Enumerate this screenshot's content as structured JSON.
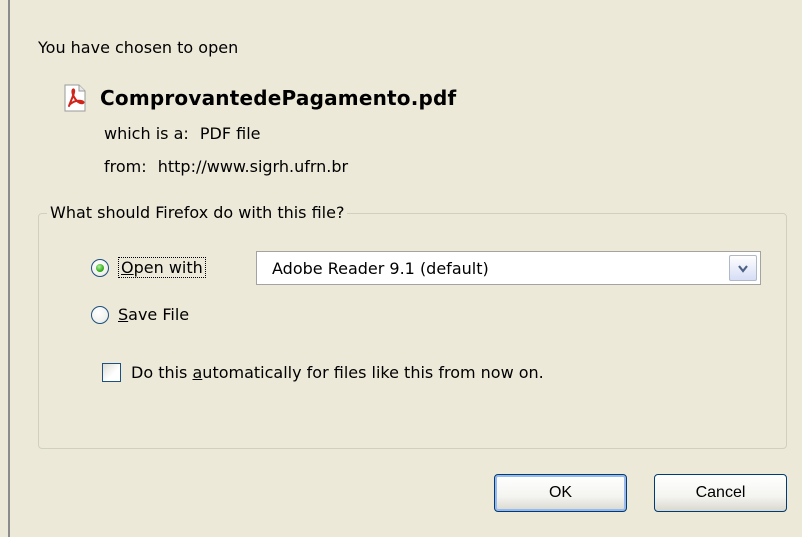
{
  "dialog": {
    "intro": "You have chosen to open",
    "file": {
      "name": "ComprovantedePagamento.pdf",
      "icon": "pdf-file-icon",
      "type_label": "which is a:",
      "type_value": "PDF file",
      "from_label": "from:",
      "from_value": "http://www.sigrh.ufrn.br"
    },
    "group": {
      "legend": "What should Firefox do with this file?",
      "open_with": {
        "selected": true,
        "label_prefix": "",
        "label_mnemonic": "O",
        "label_rest": "pen with"
      },
      "app_select": {
        "value": "Adobe Reader 9.1 (default)"
      },
      "save_file": {
        "selected": false,
        "label_mnemonic": "S",
        "label_rest": "ave File"
      },
      "auto": {
        "checked": false,
        "label_prefix": "Do this ",
        "label_mnemonic": "a",
        "label_rest": "utomatically for files like this from now on."
      }
    },
    "buttons": {
      "ok": "OK",
      "cancel": "Cancel"
    }
  }
}
